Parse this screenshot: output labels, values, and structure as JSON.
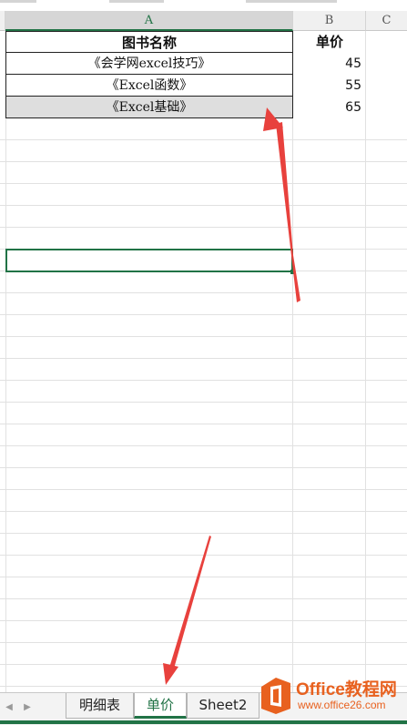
{
  "columns": {
    "a": "A",
    "b": "B",
    "c": "C"
  },
  "table": {
    "header": {
      "name": "图书名称",
      "price": "单价"
    },
    "rows": [
      {
        "name": "《会学网excel技巧》",
        "price": "45"
      },
      {
        "name": "《Excel函数》",
        "price": "55"
      },
      {
        "name": "《Excel基础》",
        "price": "65"
      }
    ]
  },
  "sheet_tabs": {
    "nav_prev": "◀",
    "nav_next": "▶",
    "tabs": [
      {
        "label": "明细表",
        "active": false
      },
      {
        "label": "单价",
        "active": true
      },
      {
        "label": "Sheet2",
        "active": false
      }
    ]
  },
  "watermark": {
    "title": "Office教程网",
    "url": "www.office26.com"
  },
  "colors": {
    "accent": "#217346",
    "annotation_arrow": "#e8413d",
    "watermark": "#e8611f"
  }
}
